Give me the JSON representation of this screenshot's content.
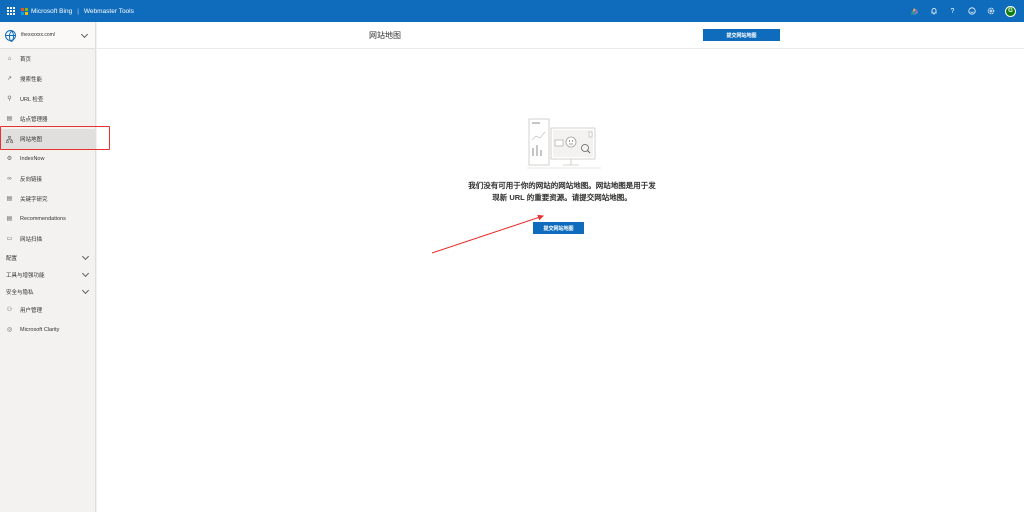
{
  "topbar": {
    "brand": "Microsoft Bing",
    "product": "Webmaster Tools",
    "avatar_initial": "G"
  },
  "sidebar": {
    "site": "thexxxxxx.com/",
    "items": [
      {
        "label": "首页",
        "icon": "home-icon"
      },
      {
        "label": "搜索性能",
        "icon": "trend-icon"
      },
      {
        "label": "URL 检查",
        "icon": "search-icon"
      },
      {
        "label": "站点管理器",
        "icon": "document-icon"
      },
      {
        "label": "网站地图",
        "icon": "sitemap-icon",
        "active": true
      },
      {
        "label": "IndexNow",
        "icon": "settings-icon"
      },
      {
        "label": "反向链接",
        "icon": "link-icon"
      },
      {
        "label": "关键字研究",
        "icon": "document-icon"
      },
      {
        "label": "Recommendations",
        "icon": "document-icon"
      },
      {
        "label": "网站扫描",
        "icon": "scan-icon"
      }
    ],
    "groups": [
      {
        "label": "配置"
      },
      {
        "label": "工具与增强功能"
      },
      {
        "label": "安全与隐私"
      }
    ],
    "bottom_items": [
      {
        "label": "用户管理",
        "icon": "user-icon"
      },
      {
        "label": "Microsoft Clarity",
        "icon": "clarity-icon"
      }
    ]
  },
  "main": {
    "title": "网站地图",
    "header_button": "提交网站地图",
    "empty_line1": "我们没有可用于你的网站的网站地图。网站地图是用于发",
    "empty_line2": "现新 URL 的重要资源。请提交网站地图。",
    "center_button": "提交网站地图"
  },
  "colors": {
    "accent": "#0f6cbd",
    "highlight": "#e8322e"
  }
}
